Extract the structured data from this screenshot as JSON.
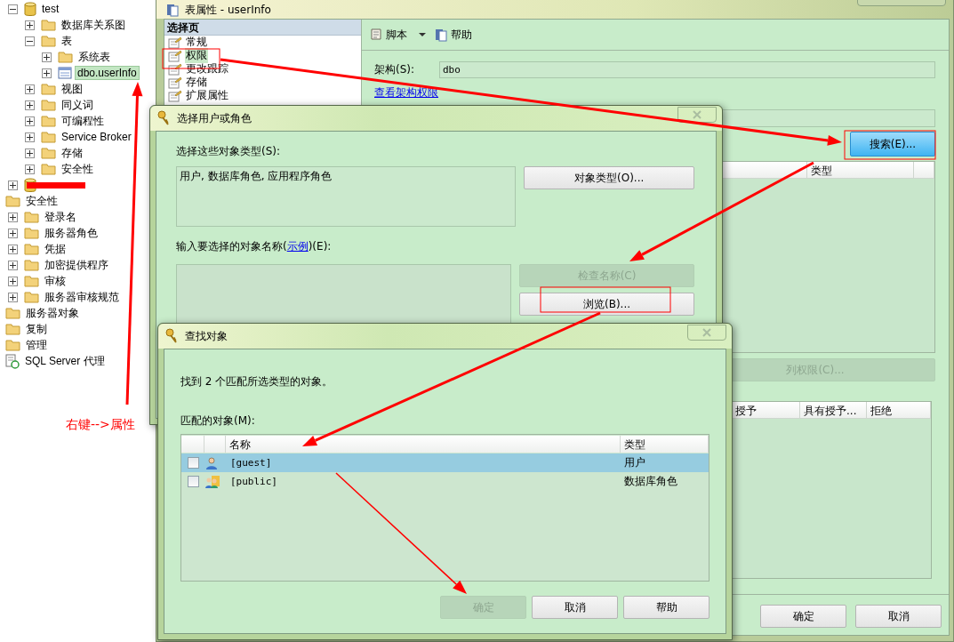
{
  "tree": [
    {
      "label": "test",
      "kind": "database",
      "expandable": true,
      "expanded": true,
      "selected": false,
      "children": [
        {
          "label": "数据库关系图",
          "kind": "folder",
          "expandable": true,
          "expanded": false,
          "selected": false
        },
        {
          "label": "表",
          "kind": "folder",
          "expandable": true,
          "expanded": true,
          "selected": false,
          "children": [
            {
              "label": "系统表",
              "kind": "folder",
              "expandable": true,
              "expanded": false,
              "selected": false
            },
            {
              "label": "dbo.userInfo",
              "kind": "table",
              "expandable": true,
              "expanded": false,
              "selected": true
            }
          ]
        },
        {
          "label": "视图",
          "kind": "folder",
          "expandable": true,
          "expanded": false,
          "selected": false
        },
        {
          "label": "同义词",
          "kind": "folder",
          "expandable": true,
          "expanded": false,
          "selected": false
        },
        {
          "label": "可编程性",
          "kind": "folder",
          "expandable": true,
          "expanded": false,
          "selected": false
        },
        {
          "label": "Service Broker",
          "kind": "folder",
          "expandable": true,
          "expanded": false,
          "selected": false
        },
        {
          "label": "存储",
          "kind": "folder",
          "expandable": true,
          "expanded": false,
          "selected": false
        },
        {
          "label": "安全性",
          "kind": "folder",
          "expandable": true,
          "expanded": false,
          "selected": false
        }
      ]
    },
    {
      "kind": "database",
      "expandable": true,
      "expanded": false,
      "redacted": true
    },
    {
      "label": "安全性",
      "kind": "folder",
      "expandable": false,
      "selected": false,
      "children": [
        {
          "label": "登录名",
          "kind": "folder",
          "expandable": true,
          "expanded": false,
          "selected": false
        },
        {
          "label": "服务器角色",
          "kind": "folder",
          "expandable": true,
          "expanded": false,
          "selected": false
        },
        {
          "label": "凭据",
          "kind": "folder",
          "expandable": true,
          "expanded": false,
          "selected": false
        },
        {
          "label": "加密提供程序",
          "kind": "folder",
          "expandable": true,
          "expanded": false,
          "selected": false
        },
        {
          "label": "审核",
          "kind": "folder",
          "expandable": true,
          "expanded": false,
          "selected": false
        },
        {
          "label": "服务器审核规范",
          "kind": "folder",
          "expandable": true,
          "expanded": false,
          "selected": false
        }
      ]
    },
    {
      "label": "服务器对象",
      "kind": "folder",
      "expandable": false,
      "selected": false
    },
    {
      "label": "复制",
      "kind": "folder",
      "expandable": false,
      "selected": false
    },
    {
      "label": "管理",
      "kind": "folder",
      "expandable": false,
      "selected": false
    },
    {
      "label": "SQL Server 代理",
      "kind": "agent",
      "expandable": false,
      "selected": false
    }
  ],
  "annotation": "右键-->属性",
  "properties_window": {
    "title": "表属性 - userInfo",
    "pages_header": "选择页",
    "pages": [
      {
        "label": "常规",
        "selected": false
      },
      {
        "label": "权限",
        "selected": true
      },
      {
        "label": "更改跟踪",
        "selected": false
      },
      {
        "label": "存储",
        "selected": false
      },
      {
        "label": "扩展属性",
        "selected": false
      }
    ],
    "toolbar": [
      {
        "kind": "script",
        "label": "脚本"
      },
      {
        "kind": "help",
        "label": "帮助"
      }
    ],
    "schema_label": "架构(S):",
    "schema_value": "dbo",
    "schema_link": "查看架构权限",
    "search_button": "搜索(E)...",
    "users_columns": [
      "类型"
    ],
    "column_permissions_button": {
      "label": "列权限(C)...",
      "disabled": true
    },
    "permission_columns": [
      "授予",
      "具有授予...",
      "拒绝"
    ],
    "buttons": [
      "确定",
      "取消"
    ]
  },
  "select_dialog": {
    "title": "选择用户或角色",
    "types_label": "选择这些对象类型(S):",
    "types_value": "用户, 数据库角色, 应用程序角色",
    "object_types_button": "对象类型(O)...",
    "names_label": "输入要选择的对象名称(",
    "names_link": "示例",
    "names_label_end": ")(E):",
    "check_names_button": {
      "label": "检查名称(C)",
      "disabled": true
    },
    "browse_button": "浏览(B)..."
  },
  "find_dialog": {
    "title": "查找对象",
    "found_text": "找到 2 个匹配所选类型的对象。",
    "list_label": "匹配的对象(M):",
    "columns": [
      "名称",
      "类型"
    ],
    "rows": [
      {
        "name": "[guest]",
        "type": "用户",
        "kind": "user",
        "checked": false,
        "selected": true
      },
      {
        "name": "[public]",
        "type": "数据库角色",
        "kind": "role",
        "checked": false,
        "selected": false
      }
    ],
    "buttons": [
      {
        "label": "确定",
        "disabled": true
      },
      {
        "label": "取消",
        "disabled": false
      },
      {
        "label": "帮助",
        "disabled": false
      }
    ]
  }
}
